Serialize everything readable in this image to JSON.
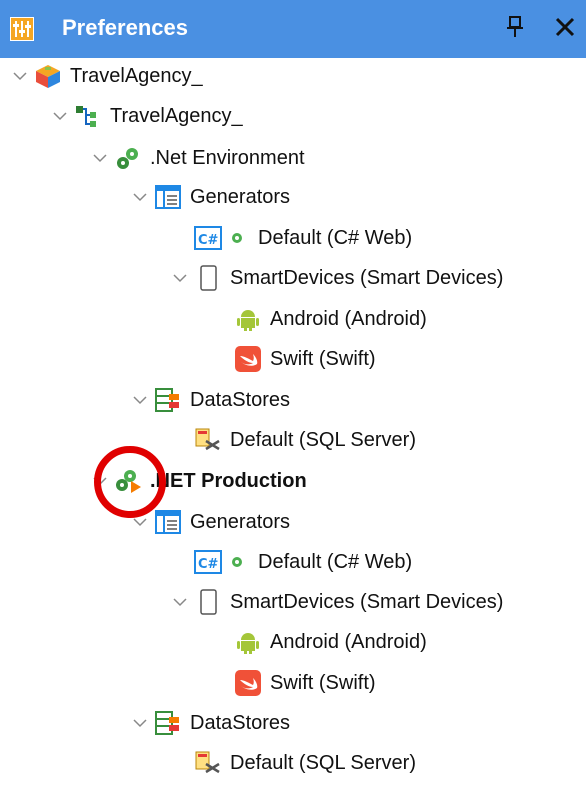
{
  "window": {
    "title": "Preferences"
  },
  "tree": [
    {
      "label": "TravelAgency_",
      "icon": "knowledge-base-icon",
      "expanded": true,
      "bold": false
    },
    {
      "label": "TravelAgency_",
      "icon": "version-tree-icon",
      "expanded": true,
      "bold": false
    },
    {
      "label": ".Net Environment",
      "icon": "environment-gears-icon",
      "expanded": true,
      "bold": false
    },
    {
      "label": "Generators",
      "icon": "generators-icon",
      "expanded": true,
      "bold": false
    },
    {
      "label": "Default (C# Web)",
      "icon": "csharp-generator-icon",
      "expanded": null,
      "bold": false
    },
    {
      "label": "SmartDevices (Smart Devices)",
      "icon": "smart-device-icon",
      "expanded": true,
      "bold": false
    },
    {
      "label": "Android (Android)",
      "icon": "android-icon",
      "expanded": null,
      "bold": false
    },
    {
      "label": "Swift (Swift)",
      "icon": "swift-icon",
      "expanded": null,
      "bold": false
    },
    {
      "label": "DataStores",
      "icon": "datastores-icon",
      "expanded": true,
      "bold": false
    },
    {
      "label": "Default (SQL Server)",
      "icon": "sql-server-icon",
      "expanded": null,
      "bold": false
    },
    {
      "label": ".NET Production",
      "icon": "active-environment-icon",
      "expanded": true,
      "bold": true
    },
    {
      "label": "Generators",
      "icon": "generators-icon",
      "expanded": true,
      "bold": false
    },
    {
      "label": "Default (C# Web)",
      "icon": "csharp-generator-icon",
      "expanded": null,
      "bold": false
    },
    {
      "label": "SmartDevices (Smart Devices)",
      "icon": "smart-device-icon",
      "expanded": true,
      "bold": false
    },
    {
      "label": "Android (Android)",
      "icon": "android-icon",
      "expanded": null,
      "bold": false
    },
    {
      "label": "Swift (Swift)",
      "icon": "swift-icon",
      "expanded": null,
      "bold": false
    },
    {
      "label": "DataStores",
      "icon": "datastores-icon",
      "expanded": true,
      "bold": false
    },
    {
      "label": "Default (SQL Server)",
      "icon": "sql-server-icon",
      "expanded": null,
      "bold": false
    }
  ],
  "colors": {
    "titlebar": "#4a90e2",
    "highlight": "#e00000",
    "gear": "#4caf50",
    "android": "#a4c639",
    "swift": "#f05138"
  }
}
